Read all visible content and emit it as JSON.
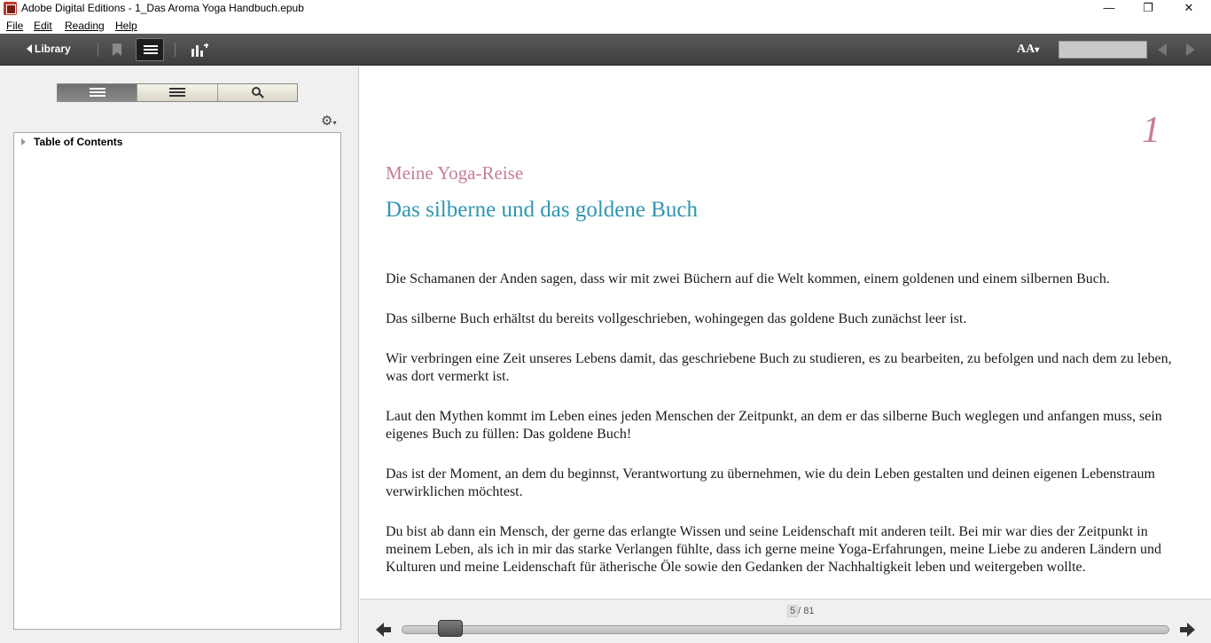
{
  "window": {
    "title": "Adobe Digital Editions - 1_Das Aroma Yoga Handbuch.epub",
    "minimize_glyph": "—",
    "maximize_glyph": "❐",
    "close_glyph": "✕"
  },
  "menu": {
    "items": [
      "File",
      "Edit",
      "Reading",
      "Help"
    ]
  },
  "toolbar": {
    "library_label": "Library",
    "font_label": "AA",
    "font_caret": "▾",
    "search_value": ""
  },
  "sidebar": {
    "tabs": [
      "table-of-contents",
      "bookmarks",
      "search"
    ],
    "active_tab": 0,
    "gear_caret": "▾",
    "toc_root": "Table of Contents"
  },
  "content": {
    "chapter_number": "1",
    "kicker": "Meine Yoga-Reise",
    "heading": "Das silberne und das goldene Buch",
    "paragraphs": [
      "Die Schamanen der Anden sagen, dass wir mit zwei Büchern auf die Welt kommen, einem goldenen und einem silbernen Buch.",
      "Das silberne Buch erhältst du bereits vollgeschrieben, wohingegen das goldene Buch zunächst leer ist.",
      "Wir verbringen eine Zeit unseres Lebens damit, das geschriebene Buch zu studieren, es zu bearbeiten, zu befolgen und nach dem zu leben, was dort vermerkt ist.",
      "Laut den Mythen kommt im Leben eines jeden Menschen der Zeitpunkt, an dem er das silberne Buch weglegen und anfangen muss, sein eigenes Buch zu füllen: Das goldene Buch!",
      "Das ist der Moment, an dem du beginnst, Verantwortung zu übernehmen, wie du dein Leben gestalten und deinen eigenen Lebenstraum verwirklichen möchtest.",
      "Du bist ab dann ein Mensch, der gerne das erlangte Wissen und seine Leidenschaft mit anderen teilt. Bei mir war dies der Zeitpunkt in meinem Leben, als ich in mir das starke Verlangen fühlte, dass ich gerne meine Yoga-Erfahrungen, meine Liebe zu anderen Ländern und Kulturen und meine Leidenschaft für ätherische Öle sowie den Gedanken der Nachhaltigkeit leben und weitergeben wollte."
    ]
  },
  "navigation": {
    "current_page": "5",
    "total_pages": "/ 81",
    "progress_fraction": 0.049
  },
  "colors": {
    "kicker": "#c77d92",
    "heading": "#2f95b3",
    "toolbar": "#4a4a4a"
  }
}
